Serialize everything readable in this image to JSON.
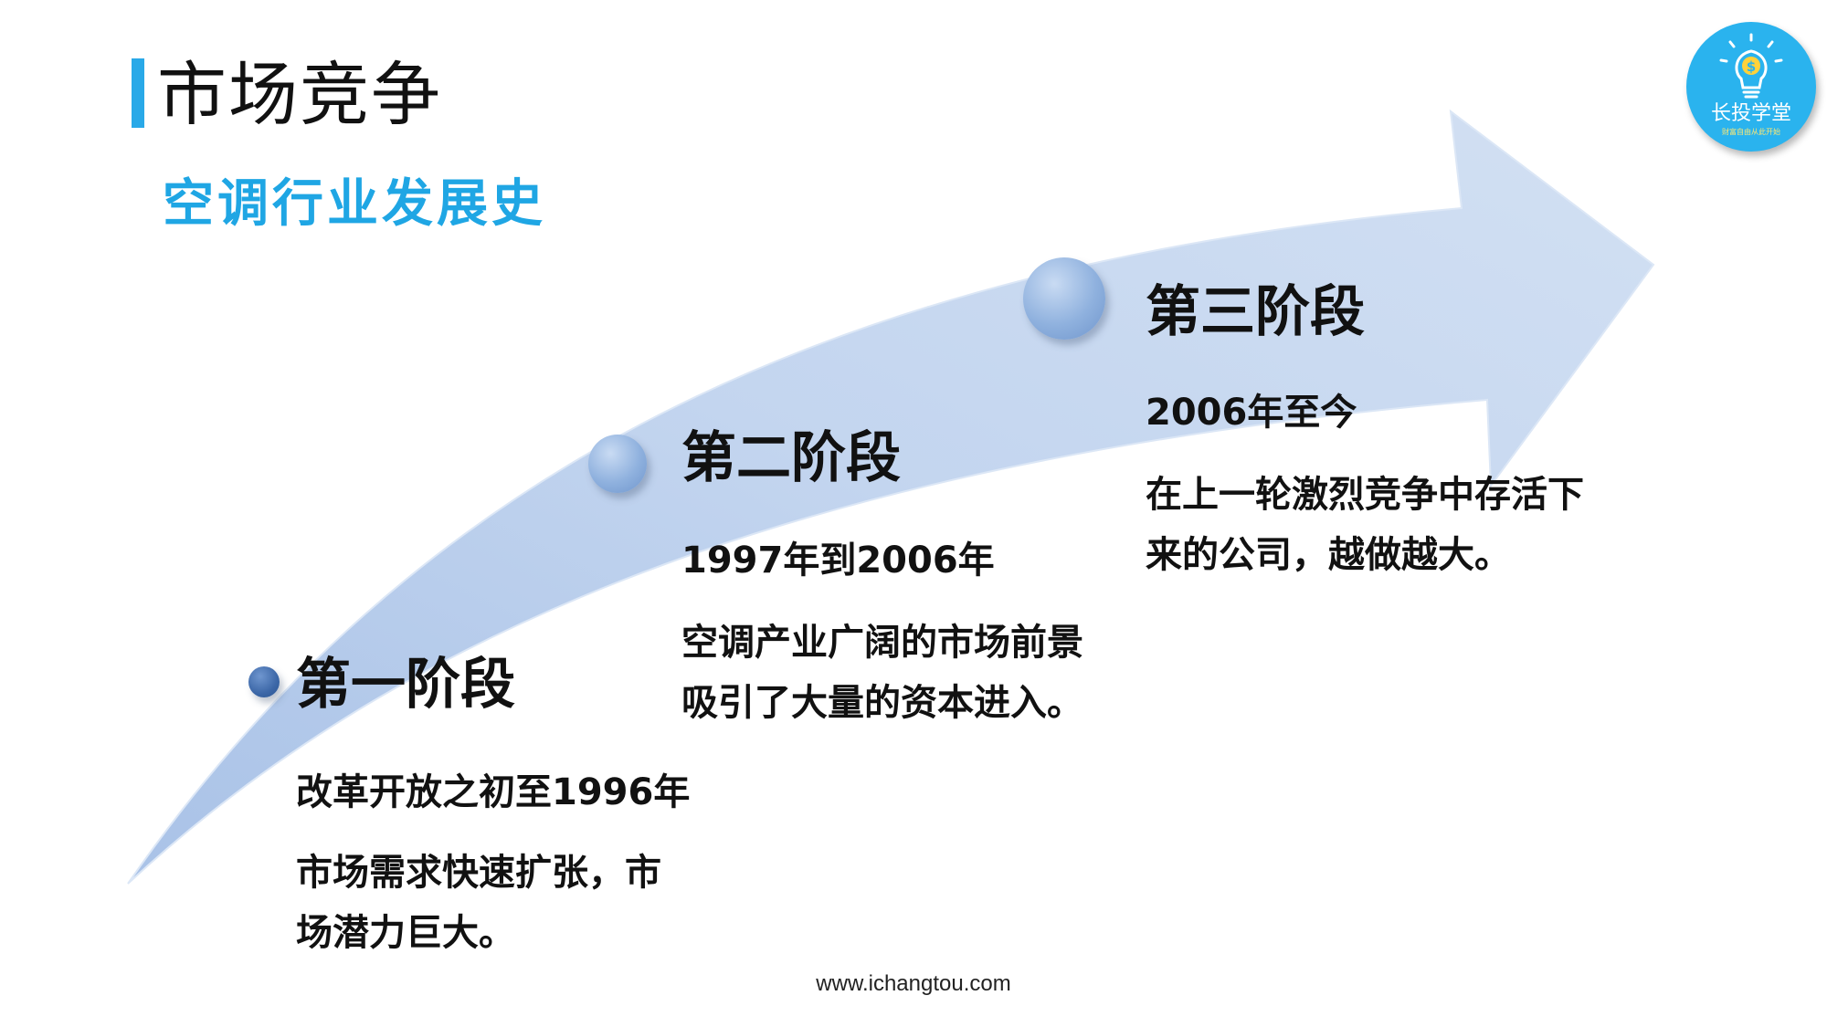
{
  "page_title": "市场竞争",
  "subtitle": "空调行业发展史",
  "stages": [
    {
      "title": "第一阶段",
      "period": "改革开放之初至1996年",
      "description_lines": [
        "市场需求快速扩张，市",
        "场潜力巨大。"
      ]
    },
    {
      "title": "第二阶段",
      "period": "1997年到2006年",
      "description_lines": [
        "空调产业广阔的市场前景",
        "吸引了大量的资本进入。"
      ]
    },
    {
      "title": "第三阶段",
      "period": "2006年至今",
      "description_lines": [
        "在上一轮激烈竞争中存活下",
        "来的公司，越做越大。"
      ]
    }
  ],
  "logo": {
    "name": "长投学堂",
    "tagline": "财富自由从此开始",
    "icon": "lightbulb-dollar-icon"
  },
  "footer_url": "www.ichangtou.com",
  "colors": {
    "accent": "#1fa6e4",
    "title_bar": "#29a9e8",
    "arrow": "#c6d7ef",
    "logo_bg": "#2ab3ee"
  }
}
